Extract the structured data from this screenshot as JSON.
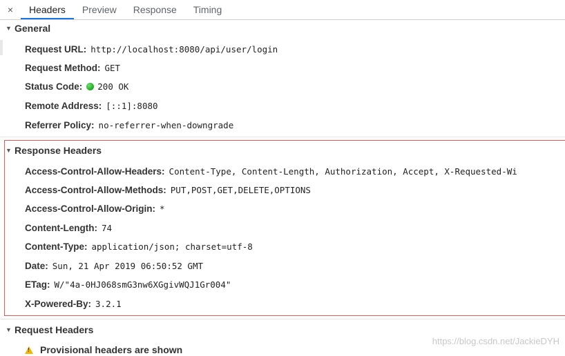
{
  "tabs": {
    "close": "×",
    "items": [
      "Headers",
      "Preview",
      "Response",
      "Timing"
    ]
  },
  "general": {
    "title": "General",
    "rows": [
      {
        "key": "Request URL:",
        "value": "http://localhost:8080/api/user/login"
      },
      {
        "key": "Request Method:",
        "value": "GET"
      },
      {
        "key": "Status Code:",
        "value": "200 OK"
      },
      {
        "key": "Remote Address:",
        "value": "[::1]:8080"
      },
      {
        "key": "Referrer Policy:",
        "value": "no-referrer-when-downgrade"
      }
    ]
  },
  "response_headers": {
    "title": "Response Headers",
    "rows": [
      {
        "key": "Access-Control-Allow-Headers:",
        "value": "Content-Type, Content-Length, Authorization, Accept, X-Requested-Wi"
      },
      {
        "key": "Access-Control-Allow-Methods:",
        "value": "PUT,POST,GET,DELETE,OPTIONS"
      },
      {
        "key": "Access-Control-Allow-Origin:",
        "value": "*"
      },
      {
        "key": "Content-Length:",
        "value": "74"
      },
      {
        "key": "Content-Type:",
        "value": "application/json; charset=utf-8"
      },
      {
        "key": "Date:",
        "value": "Sun, 21 Apr 2019 06:50:52 GMT"
      },
      {
        "key": "ETag:",
        "value": "W/\"4a-0HJ068smG3nw6XGgivWQJ1Gr004\""
      },
      {
        "key": "X-Powered-By:",
        "value": "3.2.1"
      }
    ]
  },
  "request_headers": {
    "title": "Request Headers",
    "warning": "Provisional headers are shown"
  },
  "watermark": "https://blog.csdn.net/JackieDYH",
  "colors": {
    "highlight_border": "#e05a5a",
    "status_ok": "#1fa81f",
    "active_tab": "#1a73e8"
  }
}
